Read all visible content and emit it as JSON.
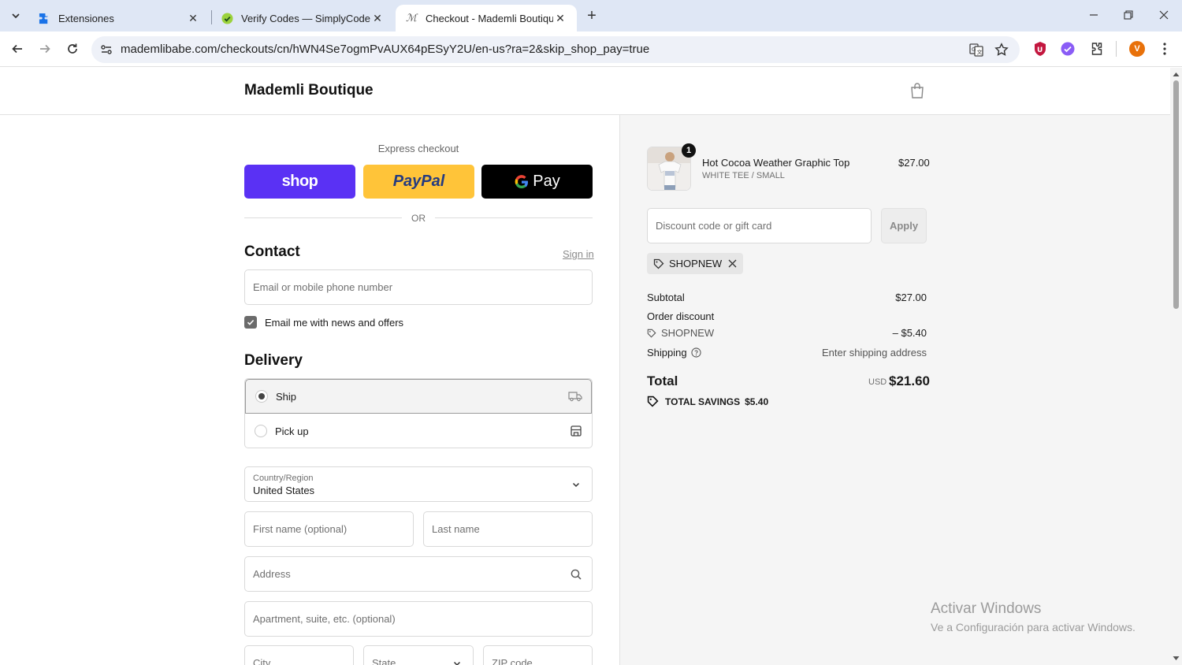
{
  "browser": {
    "tabs": [
      {
        "title": "Extensiones",
        "icon": "puzzle-icon",
        "active": false
      },
      {
        "title": "Verify Codes — SimplyCodes",
        "icon": "simplycodes-icon",
        "active": false
      },
      {
        "title": "Checkout - Mademli Boutique",
        "icon": "mademli-icon",
        "active": true
      }
    ],
    "url": "mademlibabe.com/checkouts/cn/hWN4Se7ogmPvAUX64pESyY2U/en-us?ra=2&skip_shop_pay=true",
    "profile_initial": "V"
  },
  "header": {
    "store_name": "Mademli Boutique"
  },
  "express": {
    "label": "Express checkout",
    "shop": "shop",
    "paypal": "PayPal",
    "gpay": "Pay",
    "or": "OR",
    "colors": {
      "shop": "#5a31f4",
      "paypal": "#ffc439",
      "gpay": "#000000"
    }
  },
  "contact": {
    "title": "Contact",
    "sign_in": "Sign in",
    "email_placeholder": "Email or mobile phone number",
    "newsletter_label": "Email me with news and offers",
    "newsletter_checked": true
  },
  "delivery": {
    "title": "Delivery",
    "options": [
      {
        "label": "Ship",
        "selected": true
      },
      {
        "label": "Pick up",
        "selected": false
      }
    ],
    "country_label": "Country/Region",
    "country_value": "United States",
    "first_name_placeholder": "First name (optional)",
    "last_name_placeholder": "Last name",
    "address_placeholder": "Address",
    "apartment_placeholder": "Apartment, suite, etc. (optional)",
    "city_placeholder": "City",
    "state_placeholder": "State",
    "zip_placeholder": "ZIP code"
  },
  "summary": {
    "product": {
      "name": "Hot Cocoa Weather Graphic Top",
      "variant": "WHITE TEE / SMALL",
      "price": "$27.00",
      "quantity": "1"
    },
    "discount_placeholder": "Discount code or gift card",
    "apply_label": "Apply",
    "applied_code": "SHOPNEW",
    "subtotal_label": "Subtotal",
    "subtotal_value": "$27.00",
    "order_discount_label": "Order discount",
    "discount_code": "SHOPNEW",
    "discount_value": "– $5.40",
    "shipping_label": "Shipping",
    "shipping_value": "Enter shipping address",
    "total_label": "Total",
    "total_currency": "USD",
    "total_value": "$21.60",
    "savings_label": "TOTAL SAVINGS",
    "savings_value": "$5.40"
  },
  "watermark": {
    "title": "Activar Windows",
    "subtitle": "Ve a Configuración para activar Windows."
  }
}
